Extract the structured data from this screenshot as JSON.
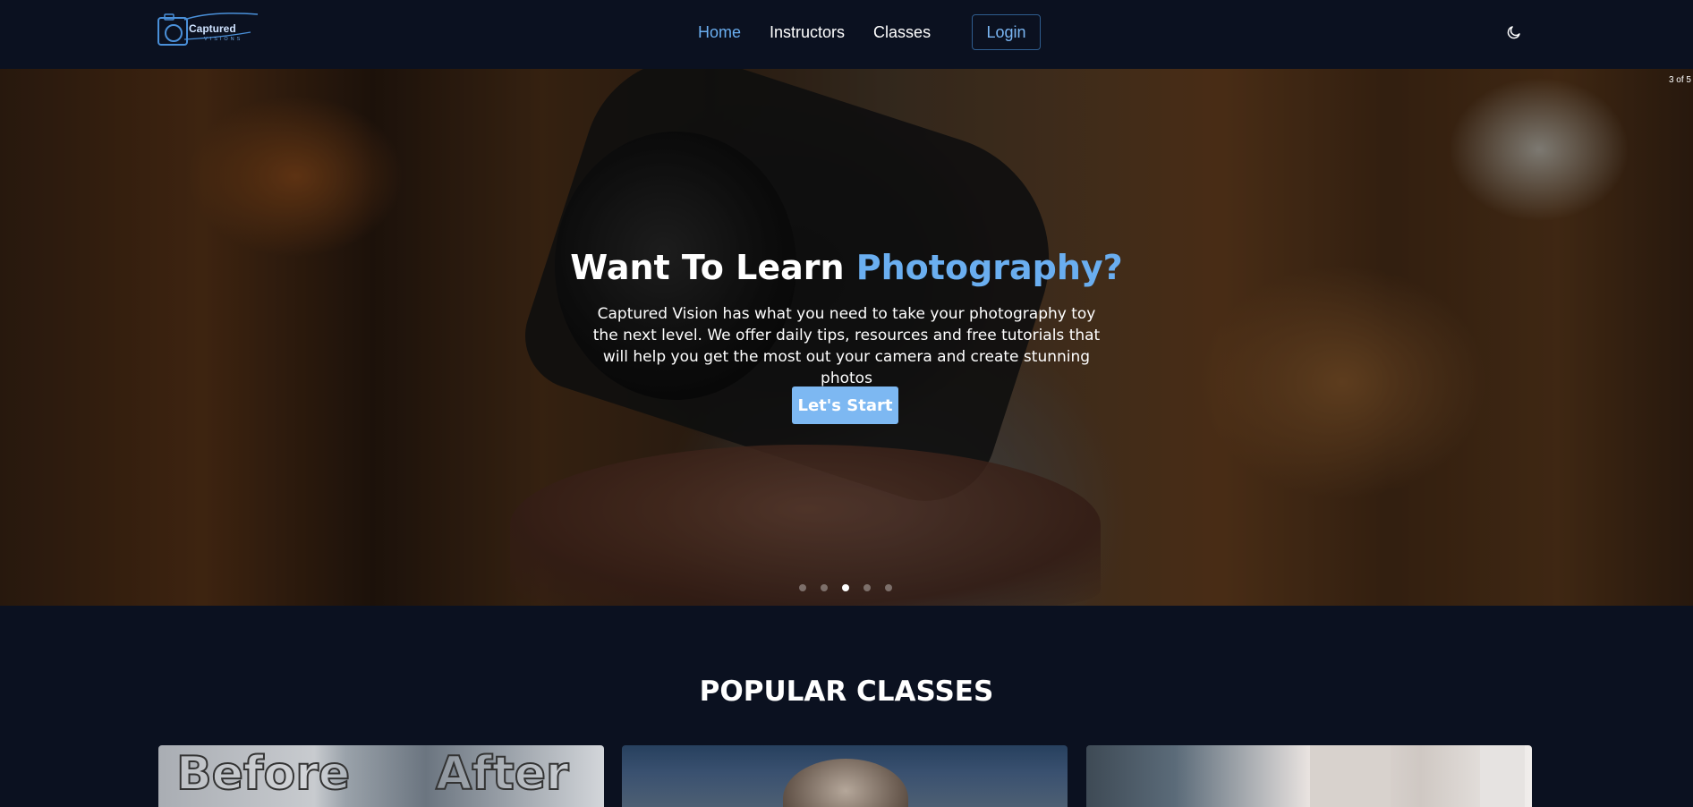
{
  "nav": {
    "logo_text": "Captured",
    "logo_sub": "VISIONS",
    "links": [
      {
        "label": "Home",
        "active": true
      },
      {
        "label": "Instructors",
        "active": false
      },
      {
        "label": "Classes",
        "active": false
      }
    ],
    "login_label": "Login",
    "theme_toggle_icon": "moon-icon"
  },
  "hero": {
    "slide_counter": "3 of 5",
    "title_plain": "Want To Learn ",
    "title_accent": "Photography?",
    "description": "Captured Vision has what you need to take your photography toy the next level. We offer daily tips, resources and free tutorials that will help you get the most out your camera and create stunning photos",
    "cta_label": "Let's Start",
    "current_slide": 3,
    "total_slides": 5
  },
  "popular": {
    "title": "POPULAR CLASSES",
    "cards": [
      {
        "words": [
          "Before",
          "After"
        ]
      },
      {
        "words": []
      },
      {
        "words": []
      }
    ]
  },
  "colors": {
    "background": "#0b1120",
    "accent": "#6aaef0",
    "cta": "#7db8f2",
    "login_border": "#2f5d8e"
  }
}
